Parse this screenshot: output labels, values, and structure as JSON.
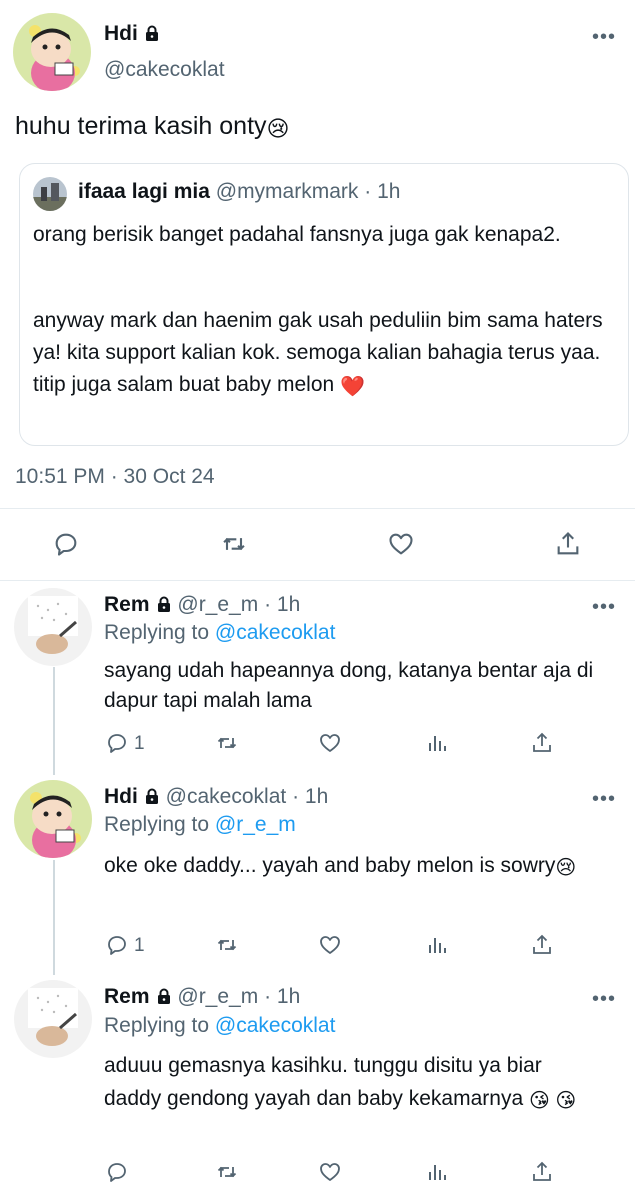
{
  "main_tweet": {
    "display_name": "Hdi",
    "handle": "@cakecoklat",
    "text": "huhu terima kasih onty",
    "text_emoji": "😢",
    "timestamp": "10:51 PM · 30 Oct 24"
  },
  "quoted_tweet": {
    "display_name": "ifaaa lagi mia",
    "handle": "@mymarkmark",
    "age": "· 1h",
    "paragraph1": "orang berisik banget padahal fansnya juga gak kenapa2.",
    "paragraph2": "anyway mark dan haenim gak usah peduliin bim sama haters ya! kita support kalian kok. semoga kalian bahagia terus yaa. titip juga salam buat baby melon",
    "paragraph2_emoji": "❤️"
  },
  "replies": [
    {
      "display_name": "Rem",
      "handle": "@r_e_m",
      "age": "· 1h",
      "replying_label": "Replying to",
      "replying_to": "@cakecoklat",
      "text": "sayang udah hapeannya dong, katanya bentar aja di dapur tapi malah lama",
      "emoji": "",
      "reply_count": "1"
    },
    {
      "display_name": "Hdi",
      "handle": "@cakecoklat",
      "age": "· 1h",
      "replying_label": "Replying to",
      "replying_to": "@r_e_m",
      "text": "oke oke daddy... yayah and baby melon is sowry",
      "emoji": "😢",
      "reply_count": "1"
    },
    {
      "display_name": "Rem",
      "handle": "@r_e_m",
      "age": "· 1h",
      "replying_label": "Replying to",
      "replying_to": "@cakecoklat",
      "text": "aduuu gemasnya kasihku. tunggu disitu ya biar daddy gendong yayah dan baby kekamarnya",
      "emoji": "😘 😘",
      "reply_count": ""
    }
  ],
  "more_label": "•••",
  "icons": {
    "reply": "reply-icon",
    "retweet": "retweet-icon",
    "like": "heart-icon",
    "share": "share-icon",
    "analytics": "analytics-icon",
    "lock": "lock-icon",
    "more": "more-icon"
  },
  "colors": {
    "link_blue": "#1d9bf0",
    "secondary_text": "#536471",
    "heart_red": "#e0245e"
  }
}
